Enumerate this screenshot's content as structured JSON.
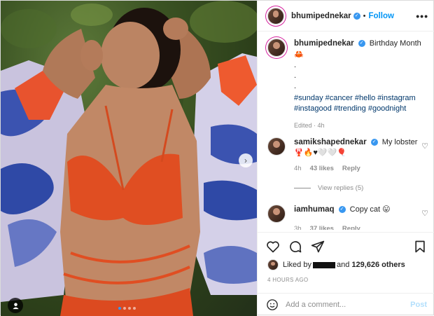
{
  "post": {
    "author": "bhumipednekar",
    "follow_label": "Follow",
    "more_label": "•••",
    "carousel": {
      "slides": 4,
      "active_index": 0
    }
  },
  "caption": {
    "username": "bhumipednekar",
    "text": "Birthday Month",
    "emoji": "🦀",
    "dot_lines": [
      ".",
      ".",
      "."
    ],
    "hashtags": [
      "#sunday",
      "#cancer",
      "#hello",
      "#instagram",
      "#instagood",
      "#trending",
      "#goodnight"
    ],
    "edited": "Edited · 4h"
  },
  "comments": [
    {
      "username": "samikshapednekar",
      "text": "My lobster",
      "emojis": "🦞🔥♥🤍🤍🎈",
      "time": "4h",
      "likes": "43 likes",
      "reply": "Reply",
      "view_replies": "View replies (5)"
    },
    {
      "username": "iamhumaq",
      "text": "Copy cat",
      "emojis": "😛",
      "time": "3h",
      "likes": "37 likes",
      "reply": "Reply"
    }
  ],
  "likes": {
    "prefix": "Liked by",
    "middle": "and",
    "others": "129,626 others"
  },
  "time_ago": "4 HOURS AGO",
  "add_comment": {
    "placeholder": "Add a comment...",
    "post_label": "Post"
  },
  "colors": {
    "link_blue": "#0095f6",
    "hashtag_blue": "#00376b",
    "meta_gray": "#8e8e8e",
    "post_disabled": "#b2dffc",
    "verified_blue": "#3897f0"
  }
}
